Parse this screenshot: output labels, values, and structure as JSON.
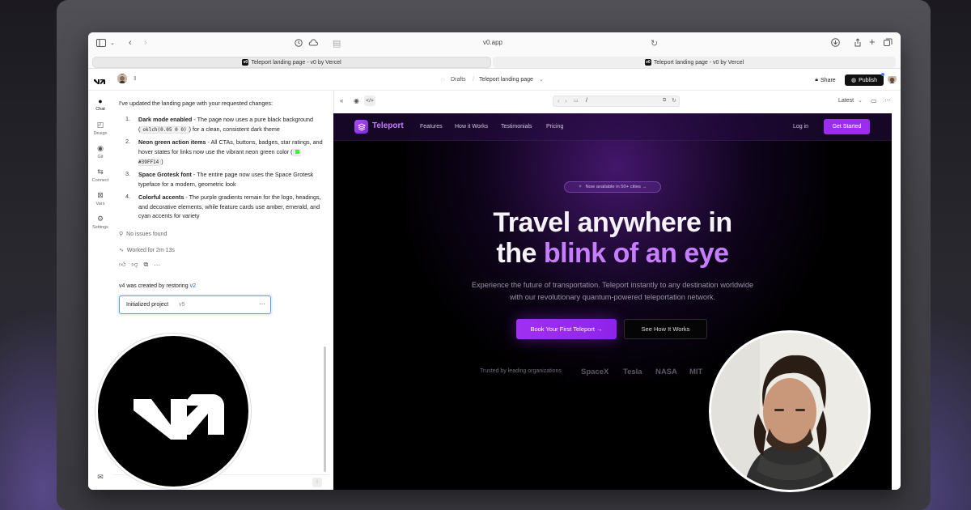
{
  "browser": {
    "url": "v0.app",
    "tabs": [
      "Teleport landing page - v0 by Vercel",
      "Teleport landing page - v0 by Vercel"
    ]
  },
  "appbar": {
    "breadcrumb_drafts": "Drafts",
    "breadcrumb_project": "Teleport landing page",
    "share_label": "Share",
    "publish_label": "Publish"
  },
  "sidebar": {
    "items": [
      {
        "label": "Chat",
        "icon": "chat-bubble-icon"
      },
      {
        "label": "Design",
        "icon": "design-icon"
      },
      {
        "label": "Git",
        "icon": "git-icon"
      },
      {
        "label": "Connect",
        "icon": "connect-icon"
      },
      {
        "label": "Vars",
        "icon": "vars-icon"
      },
      {
        "label": "Settings",
        "icon": "gear-icon"
      }
    ]
  },
  "chat": {
    "intro": "I've updated the landing page with your requested changes:",
    "list": [
      {
        "num": "1.",
        "title": "Dark mode enabled",
        "pre": " - The page now uses a pure black background (",
        "code": "oklch(0.05 0 0)",
        "post": ") for a clean, consistent dark theme"
      },
      {
        "num": "2.",
        "title": "Neon green action items",
        "pre": " - All CTAs, buttons, badges, star ratings, and hover states for links now use the vibrant neon green color (",
        "code": "#39FF14",
        "post": ")"
      },
      {
        "num": "3.",
        "title": "Space Grotesk font",
        "pre": " - The entire page now uses the Space Grotesk typeface for a modern, geometric look",
        "code": "",
        "post": ""
      },
      {
        "num": "4.",
        "title": "Colorful accents",
        "pre": " - The purple gradients remain for the logo, headings, and decorative elements, while feature cards use amber, emerald, and cyan accents for variety",
        "code": "",
        "post": ""
      }
    ],
    "no_issues": "No issues found",
    "worked_for": "Worked for 2m 13s",
    "restore_text": "v4 was created by restoring",
    "restore_link": "v2",
    "version_card": {
      "label": "Initialized project",
      "version": "v5"
    }
  },
  "preview_bar": {
    "path": "/",
    "version_select": "Latest"
  },
  "site": {
    "brand": "Teleport",
    "nav": [
      "Features",
      "How it Works",
      "Testimonials",
      "Pricing"
    ],
    "login": "Log in",
    "get_started": "Get Started",
    "badge": "Now available in 50+ cities →",
    "headline_1": "Travel anywhere in",
    "headline_2a": "the ",
    "headline_2b": "blink of an eye",
    "subtitle": "Experience the future of transportation. Teleport instantly to any destination worldwide with our revolutionary quantum-powered teleportation network.",
    "cta_primary": "Book Your First Teleport →",
    "cta_secondary": "See How It Works",
    "trusted_label": "Trusted by leading organizations",
    "logos": [
      "SpaceX",
      "Tesla",
      "NASA",
      "MIT"
    ]
  },
  "colors": {
    "accent_purple": "#9b2cf0",
    "headline_accent": "#c77dff",
    "neon_green": "#39FF14"
  }
}
